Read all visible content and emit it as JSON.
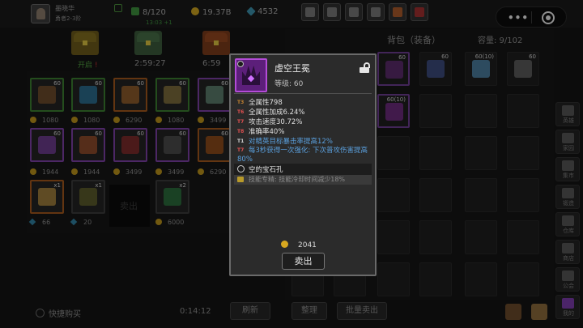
{
  "player": {
    "name": "墨晓华",
    "rank": "勇者2-3阶",
    "energy": "8/120",
    "energy_timer": "13:03 +1",
    "gold": "19.37B",
    "gems": "4532"
  },
  "chests": [
    {
      "label": "开启"
    },
    {
      "label": "2:59:27"
    },
    {
      "label": "6:59"
    }
  ],
  "shop": {
    "row1_levels": [
      "60",
      "60",
      "60",
      "60",
      "60"
    ],
    "row1_prices": [
      "1080",
      "1080",
      "6290",
      "1080",
      "3499"
    ],
    "row2_levels": [
      "60",
      "60",
      "60",
      "60",
      "60"
    ],
    "row2_prices": [
      "1944",
      "1944",
      "3499",
      "3499",
      "6290"
    ],
    "row3_counts": [
      "x1",
      "x1",
      "",
      "x2"
    ],
    "row3_prices": [
      "66",
      "20",
      "",
      "6000"
    ],
    "sold_label": "卖出",
    "quick_buy": "快捷购买",
    "refresh_timer": "0:14:12",
    "refresh_button": "刷新"
  },
  "bag": {
    "title": "背包（装备）",
    "capacity": "容量: 9/102",
    "levels": [
      "60",
      "60",
      "60(10)",
      "60",
      "60(10)",
      "60"
    ],
    "sort_button": "整理",
    "bulk_sell_button": "批量卖出"
  },
  "side_nav": [
    "英雄",
    "家园",
    "集市",
    "锻造",
    "仓库",
    "商店",
    "公会",
    "我的"
  ],
  "tooltip": {
    "name": "虚空王冕",
    "level": "等级: 60",
    "stats": [
      {
        "tier": "T3",
        "text": "全属性798"
      },
      {
        "tier": "T6",
        "text": "全属性加成6.24%"
      },
      {
        "tier": "T7",
        "text": "攻击速度30.72%"
      },
      {
        "tier": "T8",
        "text": "准确率40%"
      },
      {
        "tier": "T1",
        "text": "对精英目标暴击率提高12%"
      },
      {
        "tier": "T7",
        "text": "每3秒获得一次强化: 下次普攻伤害提高80%"
      }
    ],
    "socket": "空的宝石孔",
    "mastery": "技能专精: 技能冷却时间减少18%",
    "price": "2041",
    "sell_button": "卖出"
  },
  "colors": {
    "uncommon": "#3a7d30",
    "rare": "#a0561c",
    "epic": "#7b3fa4",
    "tier_text": "#e05050",
    "affix_blue": "#5a9fdc"
  }
}
